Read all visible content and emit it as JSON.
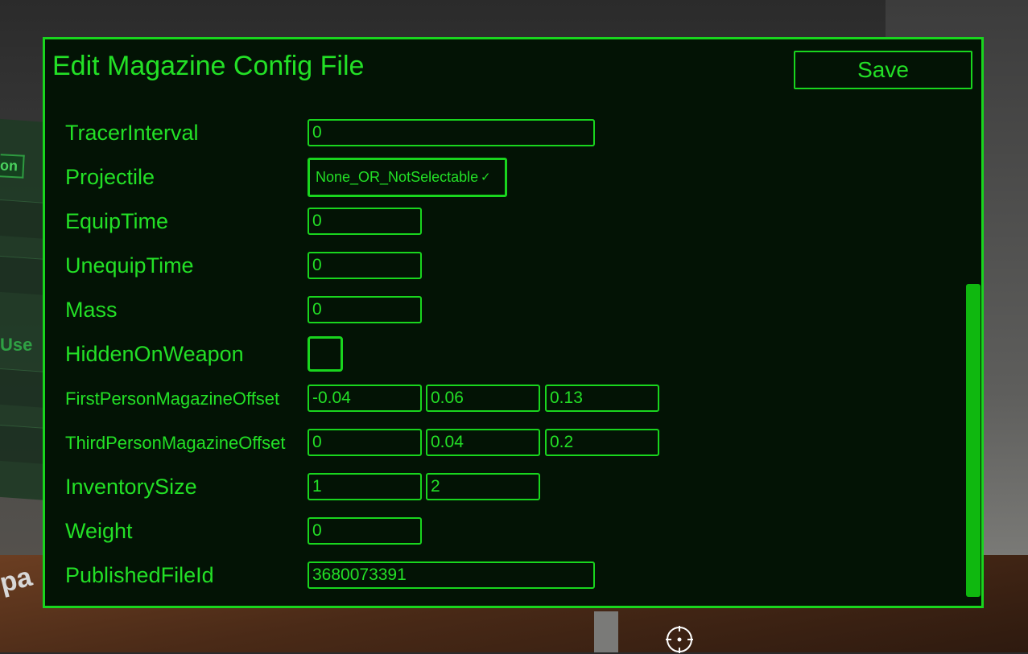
{
  "panel": {
    "title": "Edit Magazine Config File",
    "save_label": "Save"
  },
  "fields": {
    "tracer_interval": {
      "label": "TracerInterval",
      "value": "0"
    },
    "projectile": {
      "label": "Projectile",
      "value": "None_OR_NotSelectable"
    },
    "equip_time": {
      "label": "EquipTime",
      "value": "0"
    },
    "unequip_time": {
      "label": "UnequipTime",
      "value": "0"
    },
    "mass": {
      "label": "Mass",
      "value": "0"
    },
    "hidden_on_weapon": {
      "label": "HiddenOnWeapon",
      "checked": false
    },
    "first_person_offset": {
      "label": "FirstPersonMagazineOffset",
      "values": [
        "-0.04",
        "0.06",
        "0.13"
      ]
    },
    "third_person_offset": {
      "label": "ThirdPersonMagazineOffset",
      "values": [
        "0",
        "0.04",
        "0.2"
      ]
    },
    "inventory_size": {
      "label": "InventorySize",
      "values": [
        "1",
        "2"
      ]
    },
    "weight": {
      "label": "Weight",
      "value": "0"
    },
    "published_file_id": {
      "label": "PublishedFileId",
      "value": "3680073391"
    }
  },
  "background": {
    "tag_on": "on",
    "tag_use": "Use",
    "tag_pa": "pa"
  },
  "colors": {
    "accent": "#19d51e",
    "text": "#23e026",
    "panel_bg": "#031305"
  }
}
